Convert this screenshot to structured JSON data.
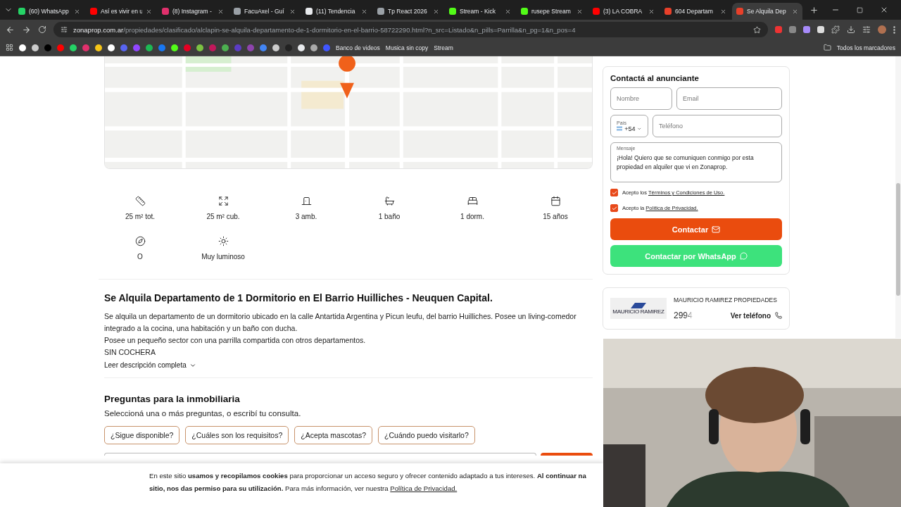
{
  "browser": {
    "tabs": [
      {
        "title": "(60) WhatsApp",
        "color": "#25d366",
        "selected": false
      },
      {
        "title": "Así es vivir en u",
        "color": "#ff0000",
        "selected": false
      },
      {
        "title": "(8) Instagram -",
        "color": "#e1306c",
        "selected": false
      },
      {
        "title": "FacuAxel - Guí",
        "color": "#9aa0a6",
        "selected": false
      },
      {
        "title": "(11) Tendencia",
        "color": "#e8eaed",
        "selected": false
      },
      {
        "title": "Tp React 2026",
        "color": "#9aa0a6",
        "selected": false
      },
      {
        "title": "Stream - Kick",
        "color": "#53fc18",
        "selected": false
      },
      {
        "title": "rusepe Stream",
        "color": "#53fc18",
        "selected": false
      },
      {
        "title": "(3) LA COBRA",
        "color": "#ff0000",
        "selected": false
      },
      {
        "title": "604 Departam",
        "color": "#e8402a",
        "selected": false
      },
      {
        "title": "Se Alquila Dep",
        "color": "#e8402a",
        "selected": true
      }
    ],
    "url": {
      "host": "zonaprop.com.ar",
      "path": "/propiedades/clasificado/alclapin-se-alquila-departamento-de-1-dormitorio-en-el-barrio-58722290.html?n_src=Listado&n_pills=Parrilla&n_pg=1&n_pos=4"
    },
    "bookmarks": [
      {
        "label": "Banco de videos"
      },
      {
        "label": "Musica sin copy"
      },
      {
        "label": "Stream"
      }
    ],
    "all_bookmarks": "Todos los marcadores"
  },
  "features": [
    {
      "kind": "area-total",
      "label": "25 m² tot."
    },
    {
      "kind": "area-covered",
      "label": "25 m² cub."
    },
    {
      "kind": "rooms",
      "label": "3 amb."
    },
    {
      "kind": "bath",
      "label": "1 baño"
    },
    {
      "kind": "bedroom",
      "label": "1 dorm."
    },
    {
      "kind": "age",
      "label": "15 años"
    },
    {
      "kind": "orientation",
      "label": "O"
    },
    {
      "kind": "light",
      "label": "Muy luminoso"
    }
  ],
  "listing": {
    "title": "Se Alquila Departamento de 1 Dormitorio en El Barrio Huilliches - Neuquen Capital.",
    "description": [
      "Se alquila un departamento de un dormitorio ubicado en la calle Antartida Argentina y Picun leufu, del barrio Huilliches. Posee un living-comedor integrado a la cocina, una habitación y un baño con ducha.",
      "Posee un pequeño sector con una parrilla compartida con otros departamentos.",
      "SIN COCHERA"
    ],
    "read_more": "Leer descripción completa"
  },
  "questions": {
    "title": "Preguntas para la inmobiliaria",
    "subtitle": "Seleccioná una o más preguntas, o escribí tu consulta.",
    "chips": [
      "¿Sigue disponible?",
      "¿Cuáles son los requisitos?",
      "¿Acepta mascotas?",
      "¿Cuándo puedo visitarlo?"
    ]
  },
  "contact": {
    "title": "Contactá al anunciante",
    "name_placeholder": "Nombre",
    "email_placeholder": "Email",
    "country_label": "País",
    "country_code": "+54",
    "phone_placeholder": "Teléfono",
    "message_label": "Mensaje",
    "message": "¡Hola! Quiero que se comuniquen conmigo por esta propiedad en alquiler que vi en Zonaprop.",
    "consents": [
      {
        "prefix": "Acepto los ",
        "link": "Términos y Condiciones de Uso.",
        "checked": true
      },
      {
        "prefix": "Acepto la ",
        "link": "Política de Privacidad.",
        "checked": true
      }
    ],
    "contact_button": "Contactar",
    "whatsapp_button": "Contactar por WhatsApp"
  },
  "advertiser": {
    "logo_text": "MAURICIO RAMIREZ",
    "name": "MAURICIO RAMIREZ PROPIEDADES",
    "phone": "2994",
    "action": "Ver teléfono"
  },
  "cookie_banner": {
    "line_1": "En este sitio **usamos y recopilamos cookies** para proporcionar un acceso seguro y ofrecer contenido adaptado a tus intereses. **Al continuar na**",
    "line_2": "**sitio, nos das permiso para su utilización.** Para más información, ver nuestra ",
    "link": "Política de Privacidad."
  }
}
